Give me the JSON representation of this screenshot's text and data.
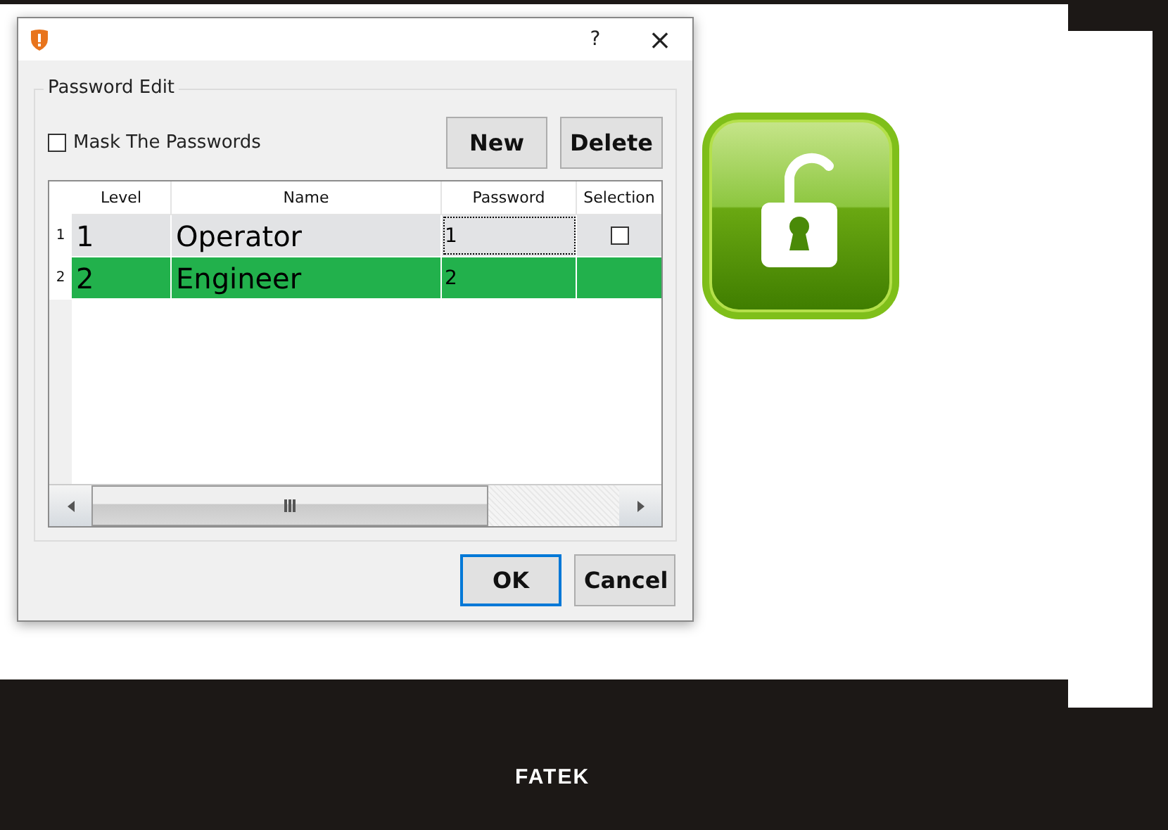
{
  "dialog": {
    "help_button": "?",
    "close_button": "×",
    "group_title": "Password Edit",
    "mask_checkbox": {
      "label": "Mask The Passwords",
      "checked": false
    },
    "buttons": [
      "New",
      "Delete"
    ],
    "table": {
      "columns": [
        "Level",
        "Name",
        "Password",
        "Selection"
      ],
      "rows": [
        {
          "number": "1",
          "level": "1",
          "name": "Operator",
          "password": "1",
          "password_focused": true,
          "checked": false,
          "selected": false
        },
        {
          "number": "2",
          "level": "2",
          "name": "Engineer",
          "password": "2",
          "password_focused": false,
          "selected": true
        }
      ]
    },
    "footer_buttons": [
      {
        "label": "OK",
        "default": true
      },
      {
        "label": "Cancel",
        "default": false
      }
    ]
  },
  "background": {
    "brand": "FATEK"
  }
}
